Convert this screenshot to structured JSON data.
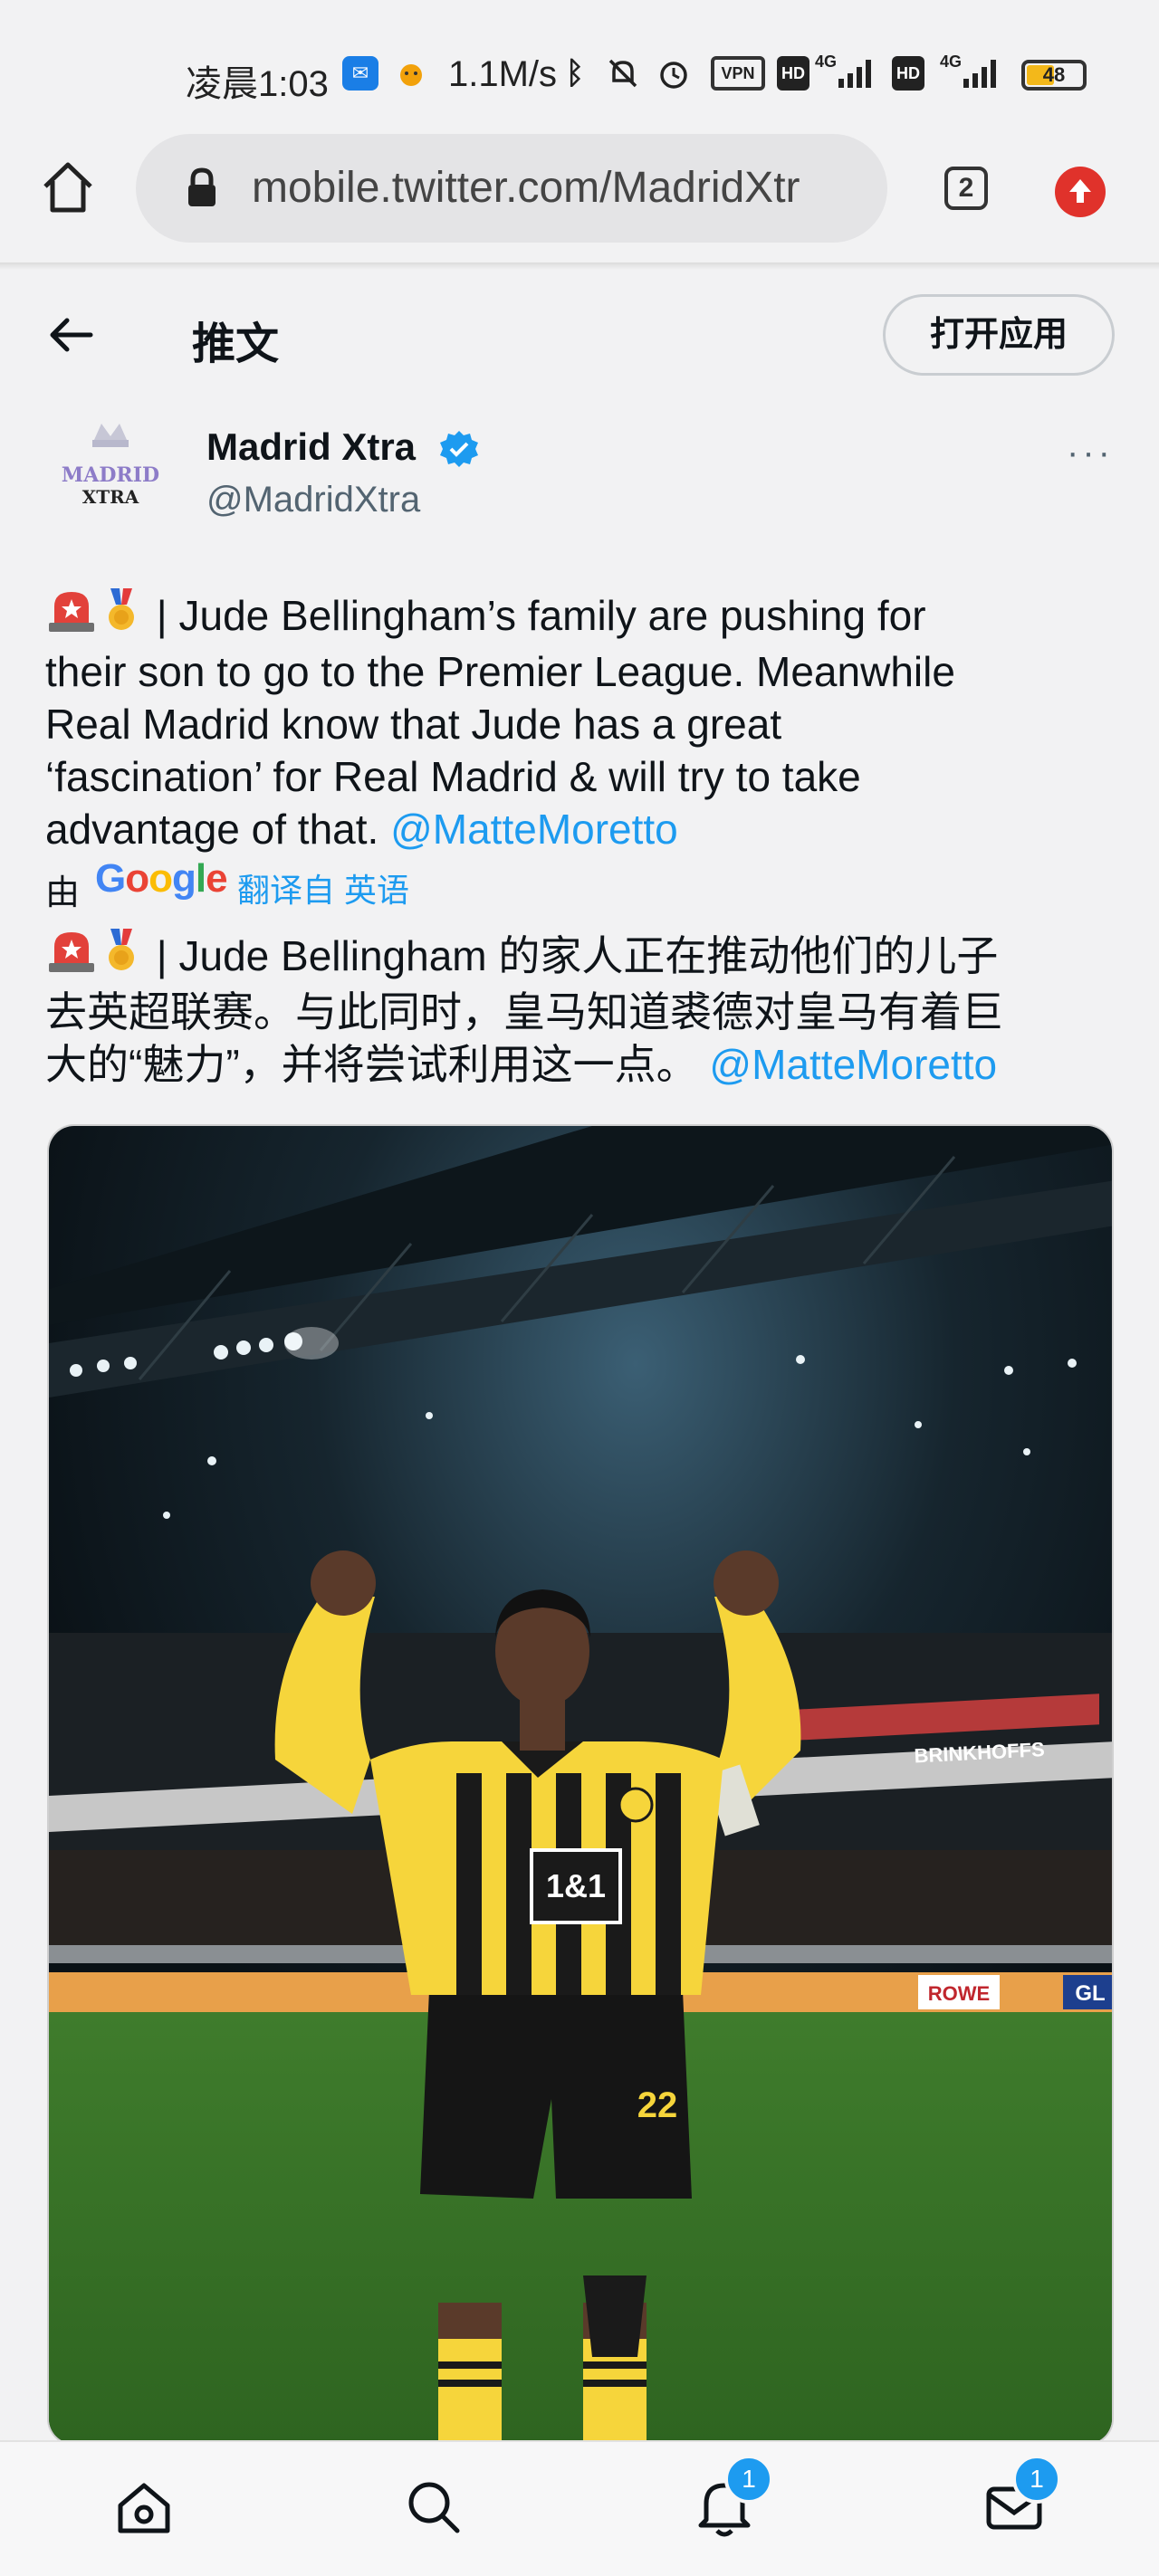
{
  "status_bar": {
    "time": "凌晨1:03",
    "speed": "1.1M/s",
    "vpn": "VPN",
    "hd": "HD",
    "network1": "4G",
    "network2": "4G",
    "battery": "48"
  },
  "browser": {
    "url": "mobile.twitter.com/MadridXtr",
    "tab_count": "2"
  },
  "header": {
    "title": "推文",
    "open_app": "打开应用"
  },
  "tweet": {
    "avatar_text_top": "MADRID",
    "avatar_text_bottom": "XTRA",
    "display_name": "Madrid Xtra",
    "handle": "@MadridXtra",
    "more": "···",
    "text_lines": [
      "| Jude Bellingham’s family are pushing for",
      "their son to go to the Premier League. Meanwhile",
      "Real Madrid know that Jude has a great",
      "‘fascination’ for Real Madrid & will try to take",
      "advantage of that."
    ],
    "mention": "@MatteMoretto",
    "translation_by": "由",
    "translation_provider": "Google",
    "translation_link": "翻译自 英语",
    "translated_lines": [
      "| Jude Bellingham 的家人正在推动他们的儿子",
      "去英超联赛。与此同时，皇马知道裘德对皇马有着巨",
      "大的“魅力”，并将尝试利用这一点。"
    ],
    "translated_mention": "@MatteMoretto",
    "image": {
      "sponsor": "1&1",
      "number": "22",
      "board_left": "BRINKHOFFS",
      "board_right": "ROWE",
      "board_edge": "GL"
    }
  },
  "bottom_nav": {
    "notifications_badge": "1",
    "messages_badge": "1"
  },
  "colors": {
    "accent": "#1d9bf0",
    "kit_yellow": "#f6d53b",
    "pitch_green": "#3e7b2e"
  }
}
